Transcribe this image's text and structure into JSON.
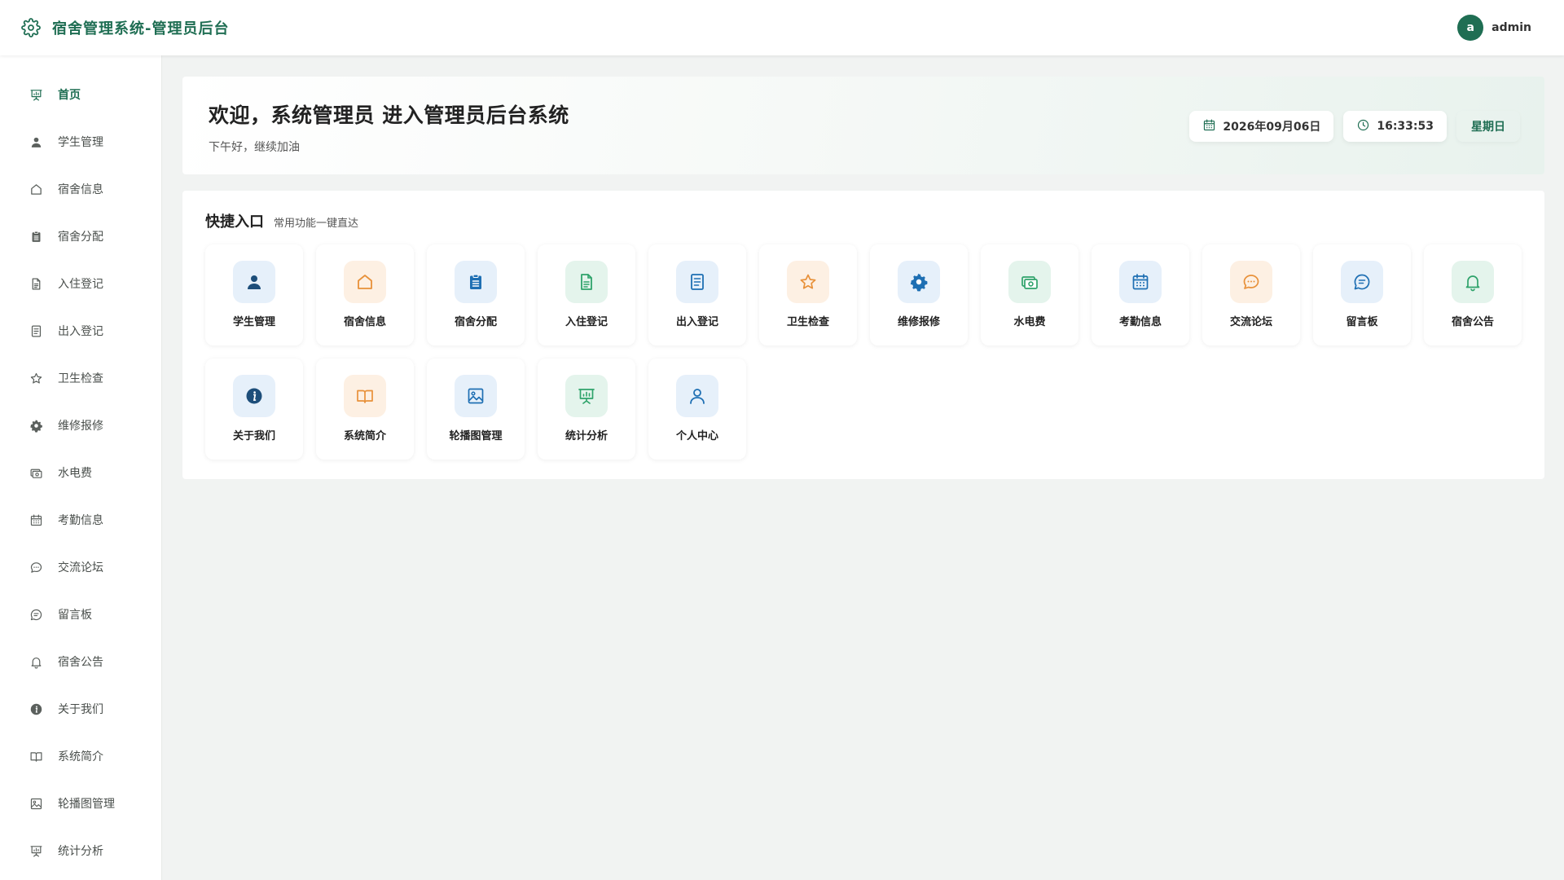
{
  "header": {
    "title": "宿舍管理系统-管理员后台",
    "brand_icon": "gear-icon",
    "avatar_letter": "a",
    "username": "admin"
  },
  "colors": {
    "primary": "#1f6e53",
    "blue": "#1e6fb3",
    "orange": "#e8913a",
    "green": "#2fa36b"
  },
  "sidebar": {
    "items": [
      {
        "label": "首页",
        "icon": "presentation-chart-icon",
        "active": true
      },
      {
        "label": "学生管理",
        "icon": "user-icon"
      },
      {
        "label": "宿舍信息",
        "icon": "home-icon"
      },
      {
        "label": "宿舍分配",
        "icon": "clipboard-icon"
      },
      {
        "label": "入住登记",
        "icon": "document-icon"
      },
      {
        "label": "出入登记",
        "icon": "list-document-icon"
      },
      {
        "label": "卫生检查",
        "icon": "star-icon"
      },
      {
        "label": "维修报修",
        "icon": "gear-icon"
      },
      {
        "label": "水电费",
        "icon": "money-icon"
      },
      {
        "label": "考勤信息",
        "icon": "calendar-icon"
      },
      {
        "label": "交流论坛",
        "icon": "chat-bubble-icon"
      },
      {
        "label": "留言板",
        "icon": "message-icon"
      },
      {
        "label": "宿舍公告",
        "icon": "bell-icon"
      },
      {
        "label": "关于我们",
        "icon": "info-icon"
      },
      {
        "label": "系统简介",
        "icon": "book-icon"
      },
      {
        "label": "轮播图管理",
        "icon": "picture-icon"
      },
      {
        "label": "统计分析",
        "icon": "presentation-chart-icon"
      }
    ]
  },
  "welcome": {
    "title": "欢迎，系统管理员 进入管理员后台系统",
    "subtitle": "下午好，继续加油",
    "date": "2026年09月06日",
    "time": "16:33:53",
    "weekday": "星期日"
  },
  "quick": {
    "title": "快捷入口",
    "subtitle": "常用功能一键直达",
    "cards": [
      {
        "label": "学生管理",
        "icon": "user-icon",
        "tone": "blue"
      },
      {
        "label": "宿舍信息",
        "icon": "home-icon",
        "tone": "orange"
      },
      {
        "label": "宿舍分配",
        "icon": "clipboard-icon",
        "tone": "blue"
      },
      {
        "label": "入住登记",
        "icon": "document-icon",
        "tone": "green"
      },
      {
        "label": "出入登记",
        "icon": "list-document-icon",
        "tone": "blue"
      },
      {
        "label": "卫生检查",
        "icon": "star-icon",
        "tone": "orange"
      },
      {
        "label": "维修报修",
        "icon": "gear-icon",
        "tone": "blue"
      },
      {
        "label": "水电费",
        "icon": "money-icon",
        "tone": "green"
      },
      {
        "label": "考勤信息",
        "icon": "calendar-icon",
        "tone": "blue"
      },
      {
        "label": "交流论坛",
        "icon": "chat-bubble-icon",
        "tone": "orange"
      },
      {
        "label": "留言板",
        "icon": "message-icon",
        "tone": "blue"
      },
      {
        "label": "宿舍公告",
        "icon": "bell-icon",
        "tone": "green"
      },
      {
        "label": "关于我们",
        "icon": "info-icon",
        "tone": "blue"
      },
      {
        "label": "系统简介",
        "icon": "book-icon",
        "tone": "orange"
      },
      {
        "label": "轮播图管理",
        "icon": "picture-icon",
        "tone": "blue"
      },
      {
        "label": "统计分析",
        "icon": "presentation-chart-icon",
        "tone": "green"
      },
      {
        "label": "个人中心",
        "icon": "person-outline-icon",
        "tone": "blue"
      }
    ]
  }
}
